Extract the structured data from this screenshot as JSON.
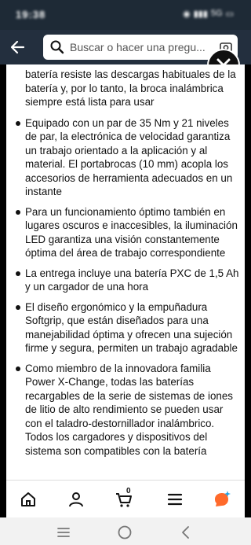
{
  "status_bar": {
    "time": "19:38",
    "network": "5G"
  },
  "header": {
    "search_placeholder": "Buscar o hacer una pregu..."
  },
  "content": {
    "bullets": [
      "batería resiste las descargas habituales de la batería y, por lo tanto, la broca inalámbrica siempre está lista para usar",
      "Equipado con un par de 35 Nm y 21 niveles de par, la electrónica de velocidad garantiza un trabajo orientado a la aplicación y al material. El portabrocas (10 mm) acopla los accesorios de herramienta adecuados en un instante",
      "Para un funcionamiento óptimo también en lugares oscuros e inaccesibles, la iluminación LED garantiza una visión constantemente óptima del área de trabajo correspondiente",
      "La entrega incluye una batería PXC de 1,5 Ah y un cargador de una hora",
      "El diseño ergonómico y la empuñadura Softgrip, que están diseñados para una manejabilidad óptima y ofrecen una sujeción firme y segura, permiten un trabajo agradable",
      "Como miembro de la innovadora familia Power X-Change, todas las baterías recargables de la serie de sistemas de iones de litio de alto rendimiento se pueden usar con el taladro-destornillador inalámbrico. Todos los cargadores y dispositivos del sistema son compatibles con la batería"
    ]
  },
  "app_nav": {
    "cart_count": "0"
  },
  "colors": {
    "header_bg": "#232f3e",
    "rufus_orange": "#ff6a2b",
    "rufus_blue": "#1ea3e6"
  }
}
